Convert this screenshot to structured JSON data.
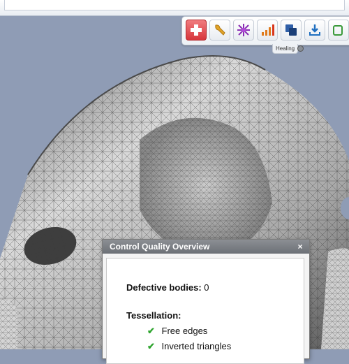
{
  "toolbar": {
    "buttons": [
      {
        "name": "heal-button",
        "icon": "red-cross-icon",
        "active": true
      },
      {
        "name": "wrench-button",
        "icon": "wrench-icon",
        "active": false
      },
      {
        "name": "star-button",
        "icon": "star-burst-icon",
        "active": false
      },
      {
        "name": "signal-button",
        "icon": "bars-icon",
        "active": false
      },
      {
        "name": "layers-button",
        "icon": "layers-icon",
        "active": false
      },
      {
        "name": "download-button",
        "icon": "download-icon",
        "active": false
      },
      {
        "name": "extra-button",
        "icon": "green-tool-icon",
        "active": false
      }
    ],
    "caption": "Healing"
  },
  "panel": {
    "title": "Control Quality Overview",
    "close_symbol": "×",
    "defective_label": "Defective bodies:",
    "defective_value": "0",
    "tessellation_heading": "Tessellation:",
    "items": [
      "Free edges",
      "Inverted triangles"
    ],
    "check_symbol": "✔"
  },
  "colors": {
    "viewport_bg": "#8f9cb5",
    "mesh_fill": "#b8b8b8",
    "check_green": "#2fa52f",
    "active_button": "#d7363b"
  }
}
